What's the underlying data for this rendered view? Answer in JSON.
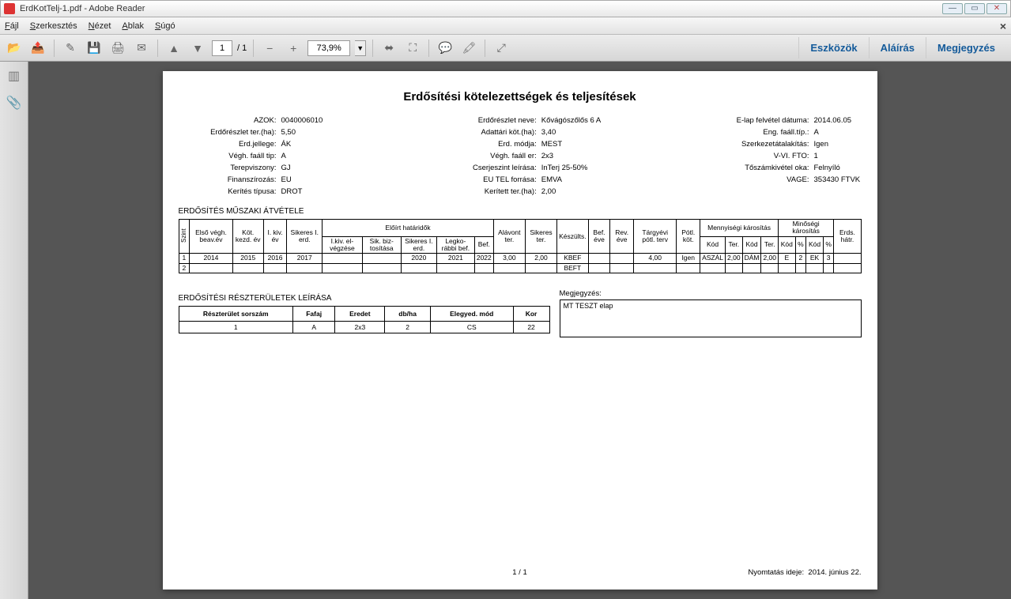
{
  "window": {
    "title": "ErdKotTelj-1.pdf - Adobe Reader"
  },
  "menu": {
    "file": "Fájl",
    "edit": "Szerkesztés",
    "view": "Nézet",
    "window": "Ablak",
    "help": "Súgó"
  },
  "toolbar": {
    "page_current": "1",
    "page_total": "/ 1",
    "zoom": "73,9%"
  },
  "rbuttons": {
    "tools": "Eszközök",
    "sign": "Aláírás",
    "comment": "Megjegyzés"
  },
  "doc": {
    "title": "Erdősítési kötelezettségek és teljesítések",
    "header": {
      "col1": [
        {
          "lbl": "AZOK:",
          "val": "0040006010"
        },
        {
          "lbl": "Erdőrészlet ter.(ha):",
          "val": "5,50"
        },
        {
          "lbl": "Erd.jellege:",
          "val": "ÁK"
        },
        {
          "lbl": "Végh. faáll tip:",
          "val": "A"
        },
        {
          "lbl": "Terepviszony:",
          "val": "GJ"
        },
        {
          "lbl": "Finanszírozás:",
          "val": "EU"
        },
        {
          "lbl": "Kerítés típusa:",
          "val": "DROT"
        }
      ],
      "col2": [
        {
          "lbl": "Erdőrészlet neve:",
          "val": "Kővágószőlős 6 A"
        },
        {
          "lbl": "Adattári köt.(ha):",
          "val": "3,40"
        },
        {
          "lbl": "Erd. módja:",
          "val": "MEST"
        },
        {
          "lbl": "Végh. faáll er:",
          "val": "2x3"
        },
        {
          "lbl": "Cserjeszint leírása:",
          "val": "InTerj 25-50%"
        },
        {
          "lbl": "EU TEL forrása:",
          "val": "EMVA"
        },
        {
          "lbl": "Kerített ter.(ha):",
          "val": "2,00"
        }
      ],
      "col3": [
        {
          "lbl": "E-lap felvétel dátuma:",
          "val": "2014.06.05"
        },
        {
          "lbl": "Eng. faáll.típ.:",
          "val": "A"
        },
        {
          "lbl": "Szerkezetátalakítás:",
          "val": "Igen"
        },
        {
          "lbl": "V-VI. FTO:",
          "val": "1"
        },
        {
          "lbl": "Tőszámkivétel oka:",
          "val": "Felnyíló"
        },
        {
          "lbl": "VAGE:",
          "val": "353430 FTVK"
        }
      ]
    },
    "section1": "ERDŐSÍTÉS MŰSZAKI ÁTVÉTELE",
    "t1": {
      "headers": {
        "szint": "Szint",
        "elso": "Első végh. beav.év",
        "kot": "Köt. kezd. év",
        "ikiv": "I. kiv. év",
        "sikeres": "Sikeres I. erd.",
        "eloirt": "Előírt határidők",
        "eloirt_sub": [
          "I.kiv. el-végzése",
          "Sik. biz-tosítása",
          "Sikeres I. erd.",
          "Legko-rábbi bef.",
          "Bef."
        ],
        "alavont": "Alávont ter.",
        "sikter": "Sikeres ter.",
        "keszults": "Készülts.",
        "befeve": "Bef. éve",
        "reveve": "Rev. éve",
        "targyevi": "Tárgyévi pótl. terv",
        "potlkot": "Pótl. köt.",
        "menny": "Mennyiségi károsítás",
        "minos": "Minőségi károsítás",
        "sub4": [
          "Kód",
          "Ter.",
          "Kód",
          "Ter."
        ],
        "sub4b": [
          "Kód",
          "%",
          "Kód",
          "%"
        ],
        "erds": "Erds. hátr."
      },
      "rows": [
        {
          "n": "1",
          "elso": "2014",
          "kot": "2015",
          "ikiv": "2016",
          "sik": "2017",
          "e1": "",
          "e2": "",
          "e3": "2020",
          "e4": "2021",
          "e5": "2022",
          "ala": "3,00",
          "sikt": "2,00",
          "kesz": "KBEF",
          "bef": "",
          "rev": "",
          "targy": "4,00",
          "potl": "Igen",
          "mk1": "ASZÁL",
          "mt1": "2,00",
          "mk2": "DÁM",
          "mt2": "2,00",
          "qk1": "E",
          "qv1": "2",
          "qk2": "EK",
          "qv2": "3",
          "erds": ""
        },
        {
          "n": "2",
          "elso": "",
          "kot": "",
          "ikiv": "",
          "sik": "",
          "e1": "",
          "e2": "",
          "e3": "",
          "e4": "",
          "e5": "",
          "ala": "",
          "sikt": "",
          "kesz": "BEFT",
          "bef": "",
          "rev": "",
          "targy": "",
          "potl": "",
          "mk1": "",
          "mt1": "",
          "mk2": "",
          "mt2": "",
          "qk1": "",
          "qv1": "",
          "qk2": "",
          "qv2": "",
          "erds": ""
        }
      ]
    },
    "section2": "ERDŐSÍTÉSI RÉSZTERÜLETEK LEÍRÁSA",
    "t2": {
      "headers": [
        "Részterület sorszám",
        "Fafaj",
        "Eredet",
        "db/ha",
        "Elegyed. mód",
        "Kor"
      ],
      "rows": [
        [
          "1",
          "A",
          "2x3",
          "2",
          "CS",
          "22"
        ]
      ]
    },
    "megjegyzes": {
      "title": "Megjegyzés:",
      "text": "MT TESZT elap"
    },
    "footer": {
      "page": "1 / 1",
      "printlbl": "Nyomtatás ideje:",
      "printval": "2014. június 22."
    }
  }
}
